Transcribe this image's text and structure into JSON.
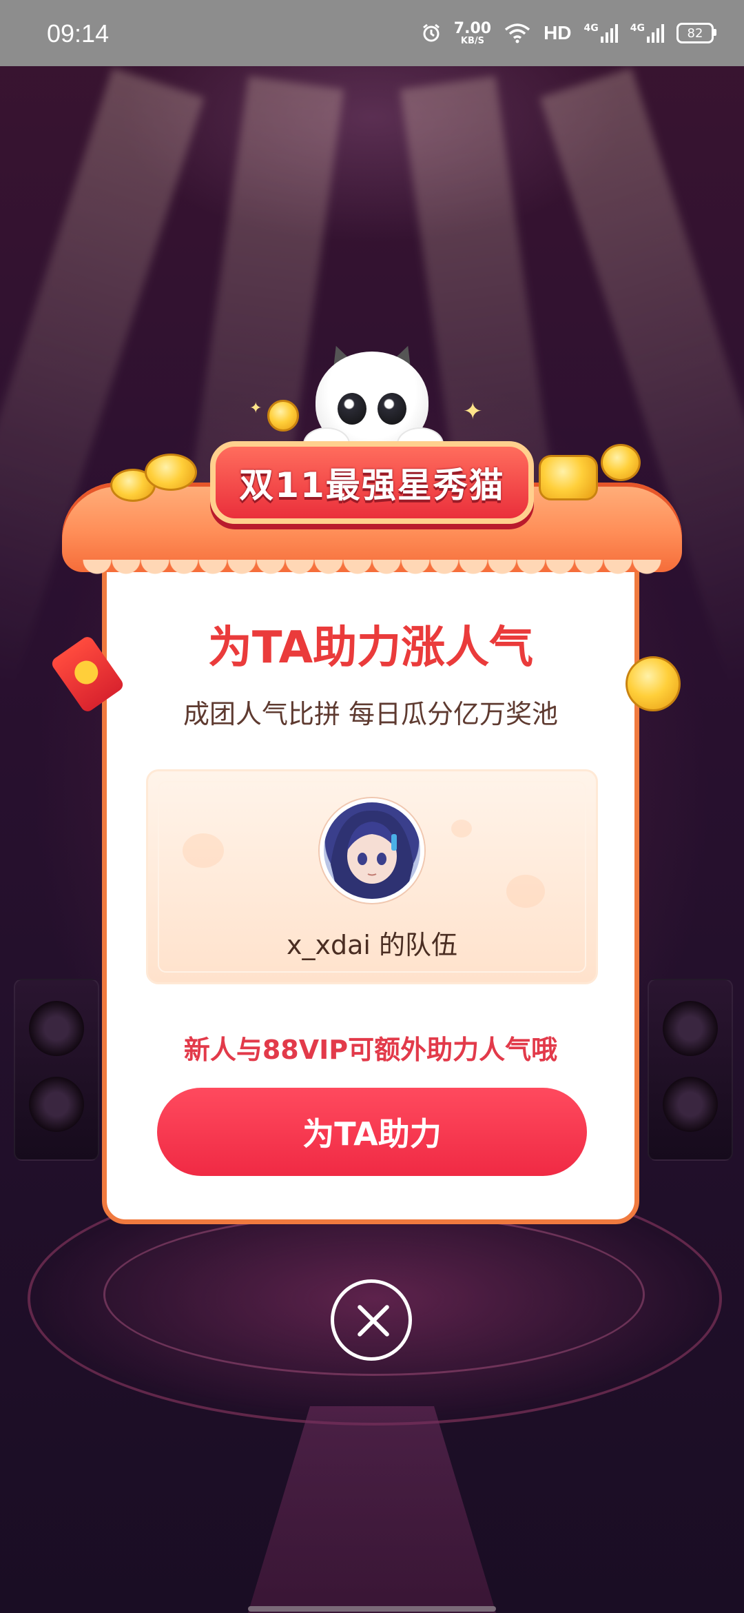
{
  "status_bar": {
    "time": "09:14",
    "net_speed_value": "7.00",
    "net_speed_unit": "KB/S",
    "hd_label": "HD",
    "signal_1": "4G",
    "signal_2": "4G",
    "battery": "82"
  },
  "popup": {
    "banner": "双11最强星秀猫",
    "title": "为TA助力涨人气",
    "subtitle": "成团人气比拼 每日瓜分亿万奖池",
    "team": {
      "name": "x_xdai 的队伍"
    },
    "hint": "新人与88VIP可额外助力人气哦",
    "cta_label": "为TA助力"
  },
  "icons": {
    "close": "close-icon",
    "alarm": "alarm-icon",
    "wifi": "wifi-icon",
    "signal": "signal-icon",
    "battery": "battery-icon"
  },
  "colors": {
    "title_red": "#ea3b3b",
    "cta_red": "#f02a44",
    "card_border": "#f07a3f",
    "status_bar_bg": "#8d8d8d"
  }
}
